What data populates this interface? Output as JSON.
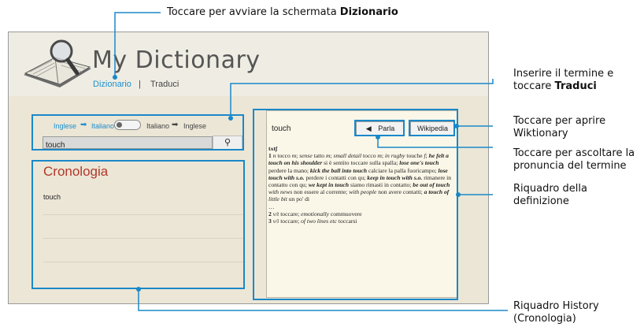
{
  "callouts": {
    "dictionary_prefix": "Toccare per avviare la schermata ",
    "dictionary_bold": "Dizionario",
    "translate_line1": "Inserire il termine e",
    "translate_line2_prefix": "toccare ",
    "translate_line2_bold": "Traduci",
    "wiktionary_line1": "Toccare per aprire",
    "wiktionary_line2": "Wiktionary",
    "pronounce_line1": "Toccare per ascoltare la",
    "pronounce_line2": "pronuncia del termine",
    "definition_line1": "Riquadro della",
    "definition_line2": "definizione",
    "history_line1": "Riquadro History",
    "history_line2": "(Cronologia)"
  },
  "app": {
    "title": "My Dictionary",
    "nav_dictionary": "Dizionario",
    "nav_separator": "|",
    "nav_translate": "Traduci",
    "accent": "#1a8fce"
  },
  "translate": {
    "source_lang": "Inglese",
    "target_lang": "Italiano",
    "reverse_source": "Italiano",
    "reverse_target": "Inglese",
    "search_value": "touch"
  },
  "history": {
    "title": "Cronologia",
    "items": [
      "touch",
      "",
      "",
      ""
    ]
  },
  "definition": {
    "word": "touch",
    "speak_label": "Parla",
    "wiki_label": "Wikipedia",
    "phonetic": "tʌtʃ"
  },
  "colors": {
    "callout": "#1a88c9",
    "history_title": "#b0382a"
  }
}
